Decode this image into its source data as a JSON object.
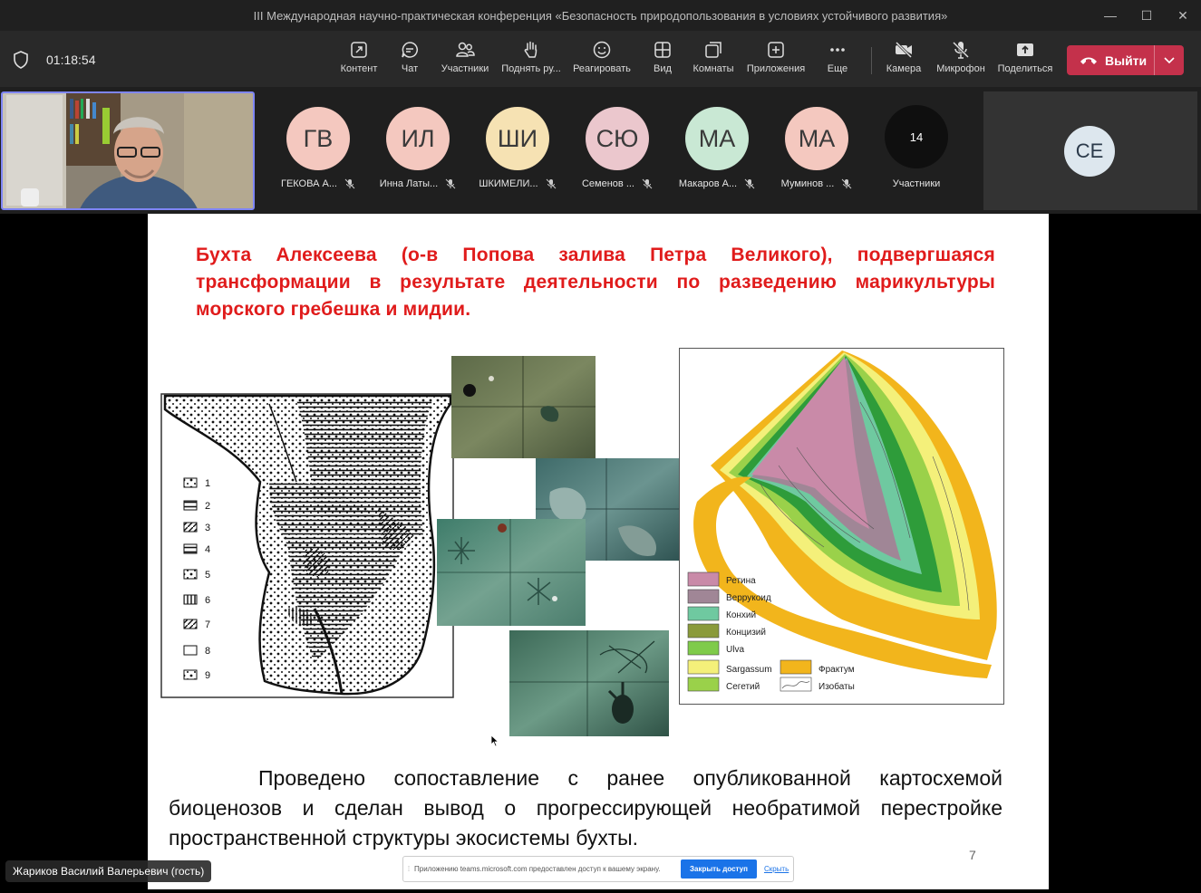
{
  "window": {
    "title": "III Международная научно-практическая конференция «Безопасность природопользования в условиях устойчивого развития»",
    "controls": [
      "—",
      "☐",
      "✕"
    ]
  },
  "toolbar": {
    "timer": "01:18:54",
    "buttons": [
      {
        "label": "Контент",
        "icon": "share-screen-icon"
      },
      {
        "label": "Чат",
        "icon": "chat-icon"
      },
      {
        "label": "Участники",
        "icon": "people-icon"
      },
      {
        "label": "Поднять ру...",
        "icon": "raise-hand-icon"
      },
      {
        "label": "Реагировать",
        "icon": "emoji-icon"
      },
      {
        "label": "Вид",
        "icon": "grid-icon"
      },
      {
        "label": "Комнаты",
        "icon": "rooms-icon"
      },
      {
        "label": "Приложения",
        "icon": "add-app-icon"
      },
      {
        "label": "Еще",
        "icon": "more-icon"
      },
      {
        "label": "Камера",
        "icon": "camera-off-icon"
      },
      {
        "label": "Микрофон",
        "icon": "mic-off-icon"
      },
      {
        "label": "Поделиться",
        "icon": "share-icon"
      }
    ],
    "leave_label": "Выйти",
    "leave_color": "#c4314b"
  },
  "participants": [
    {
      "initials": "ГВ",
      "name": "ГЕКОВА А...",
      "color": "#f4c8bf"
    },
    {
      "initials": "ИЛ",
      "name": "Инна Латы...",
      "color": "#f4c8bf"
    },
    {
      "initials": "ШИ",
      "name": "ШКИМЕЛИ...",
      "color": "#f6e2b3"
    },
    {
      "initials": "СЮ",
      "name": "Семенов ...",
      "color": "#ebc7cd"
    },
    {
      "initials": "МА",
      "name": "Макаров А...",
      "color": "#c9e8d4"
    },
    {
      "initials": "МА",
      "name": "Муминов ...",
      "color": "#f4c8bf"
    }
  ],
  "overflow": {
    "count": "14",
    "label": "Участники"
  },
  "tile_ce": {
    "initials": "СЕ"
  },
  "slide": {
    "title": "Бухта Алексеева (о-в Попова залива Петра Великого), подвергшаяся трансформации в результате деятельности по разведению марикультуры морского гребешка и мидии.",
    "body": "Проведено сопоставление с ранее опубликованной картосхемой биоценозов и сделан вывод о прогрессирующей необратимой перестройке пространственной структуры экосистемы бухты.",
    "page_number": "7",
    "left_map_legend": [
      "1",
      "2",
      "3",
      "4",
      "5",
      "6",
      "7",
      "8",
      "9"
    ],
    "right_map_legend": [
      {
        "label": "Ретина",
        "color": "#c98aa8"
      },
      {
        "label": "Веррукоид",
        "color": "#a08696"
      },
      {
        "label": "Конхий",
        "color": "#6fc9a0"
      },
      {
        "label": "Концизий",
        "color": "#8a9a3a"
      },
      {
        "label": "Ulva",
        "color": "#7fcb4a"
      },
      {
        "label": "Sargassum",
        "color": "#f4f07a"
      },
      {
        "label": "Сегетий",
        "color": "#9ad14a"
      },
      {
        "label": "Фрактум",
        "color": "#f2b51c"
      },
      {
        "label": "Изобаты",
        "color": "#ffffff"
      }
    ]
  },
  "presenter_label": "Жариков Василий Валерьевич (гость)",
  "share_banner": {
    "text": "Приложению teams.microsoft.com предоставлен доступ к вашему экрану.",
    "stop_label": "Закрыть доступ",
    "hide_label": "Скрыть"
  }
}
